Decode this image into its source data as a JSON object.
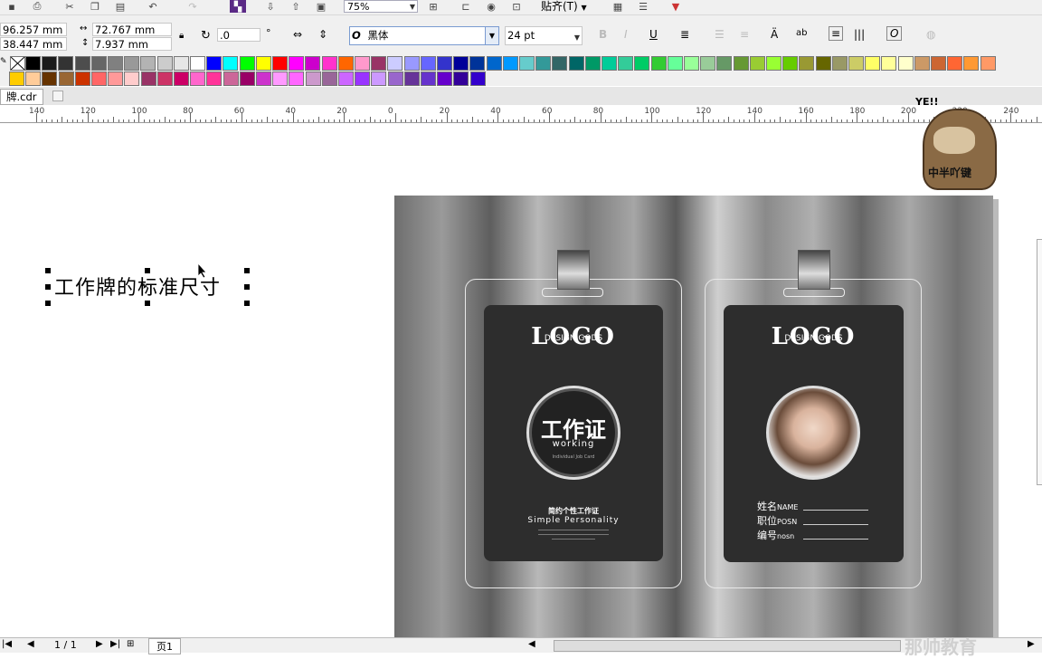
{
  "toolbar": {
    "zoom": "75%",
    "snap_label": "贴齐(T)"
  },
  "properties": {
    "x_pos": "96.257 mm",
    "y_pos": "38.447 mm",
    "width": "72.767 mm",
    "height": "7.937 mm",
    "rotation": ".0",
    "degree_symbol": "°",
    "font_name": "黑体",
    "font_icon": "O",
    "font_size": "24 pt"
  },
  "palette": {
    "row1": [
      "#000000",
      "#1a1a1a",
      "#333333",
      "#4d4d4d",
      "#666666",
      "#808080",
      "#999999",
      "#b3b3b3",
      "#cccccc",
      "#e6e6e6",
      "#ffffff",
      "#0000ff",
      "#00ffff",
      "#00ff00",
      "#ffff00",
      "#ff0000",
      "#ff00ff",
      "#cc00cc",
      "#ff33cc",
      "#ff6600",
      "#ff99cc",
      "#993366",
      "#ccccff",
      "#9999ff",
      "#6666ff",
      "#3333cc",
      "#000099",
      "#003399",
      "#0066cc",
      "#0099ff",
      "#66cccc",
      "#339999",
      "#336666",
      "#006666",
      "#009966",
      "#00cc99",
      "#33cc99",
      "#00cc66",
      "#33cc33",
      "#66ff99",
      "#99ff99",
      "#99cc99",
      "#669966",
      "#669933",
      "#99cc33",
      "#99ff33",
      "#66cc00",
      "#999933",
      "#666600",
      "#999966",
      "#cccc66",
      "#ffff66",
      "#ffff99",
      "#ffffcc",
      "#cc9966",
      "#cc6633",
      "#ff6633",
      "#ff9933",
      "#ff9966"
    ],
    "row2": [
      "#ffcc00",
      "#ffcc99",
      "#663300",
      "#996633",
      "#cc3300",
      "#ff6666",
      "#ff9999",
      "#ffcccc",
      "#993366",
      "#cc3366",
      "#cc0066",
      "#ff66cc",
      "#ff3399",
      "#cc6699",
      "#990066",
      "#cc33cc",
      "#ff99ff",
      "#ff66ff",
      "#cc99cc",
      "#996699",
      "#cc66ff",
      "#9933ff",
      "#cc99ff",
      "#9966cc",
      "#663399",
      "#6633cc",
      "#6600cc",
      "#330099",
      "#3300cc"
    ]
  },
  "tab": {
    "filename": "牌.cdr"
  },
  "ruler": {
    "labels": [
      "140",
      "120",
      "100",
      "80",
      "60",
      "40",
      "20",
      "0",
      "20",
      "40",
      "60",
      "80",
      "100",
      "120",
      "140",
      "160",
      "180",
      "200",
      "220",
      "240"
    ]
  },
  "canvas": {
    "selected_text": "工作牌的标准尺寸"
  },
  "badge_left": {
    "logo": "LOGO",
    "logo_sub": "DESIGN GODS",
    "title": "工作证",
    "working": "working",
    "tiny": "Individual Job Card",
    "slogan_cn": "简约个性工作证",
    "slogan_en": "Simple Personality"
  },
  "badge_right": {
    "logo": "LOGO",
    "logo_sub": "DESIGN GODS",
    "name_label": "姓名",
    "name_en": "NAME",
    "post_label": "职位",
    "post_en": "POSN",
    "id_label": "编号",
    "id_en": "nosn"
  },
  "sticker": {
    "top_text": "YE!!",
    "bottom_text": "中半吖键"
  },
  "statusbar": {
    "page_count": "1 / 1",
    "page_tab": "页1"
  },
  "watermark": "那帅教育"
}
